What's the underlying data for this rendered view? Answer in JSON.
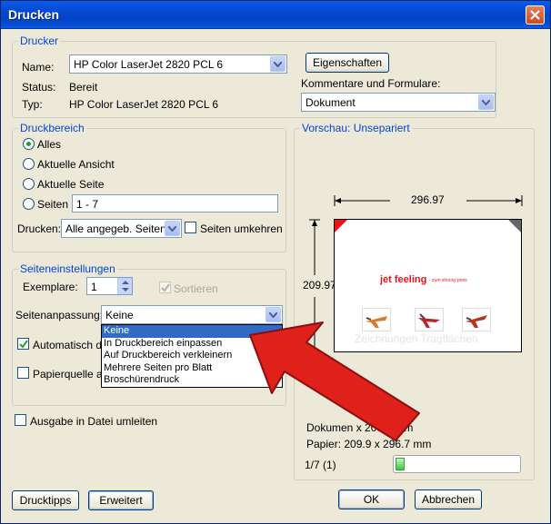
{
  "window": {
    "title": "Drucken"
  },
  "printer": {
    "legend": "Drucker",
    "name_label": "Name:",
    "name_value": "HP Color LaserJet 2820 PCL 6",
    "properties_button": "Eigenschaften",
    "status_label": "Status:",
    "status_value": "Bereit",
    "type_label": "Typ:",
    "type_value": "HP Color LaserJet 2820 PCL 6",
    "comments_label": "Kommentare und Formulare:",
    "comments_value": "Dokument"
  },
  "range": {
    "legend": "Druckbereich",
    "all": "Alles",
    "current_view": "Aktuelle Ansicht",
    "current_page": "Aktuelle Seite",
    "pages": "Seiten",
    "pages_value": "1 - 7",
    "print_label": "Drucken:",
    "print_value": "Alle angegeb. Seiten",
    "reverse_pages": "Seiten umkehren"
  },
  "page_settings": {
    "legend": "Seiteneinstellungen",
    "copies_label": "Exemplare:",
    "copies_value": "1",
    "collate": "Sortieren",
    "scaling_label": "Seitenanpassung:",
    "scaling_value": "Keine",
    "auto_rotate": "Automatisch dr",
    "paper_source": "Papierquelle ar",
    "scaling_options": [
      "Keine",
      "In Druckbereich einpassen",
      "Auf Druckbereich verkleinern",
      "Mehrere Seiten pro Blatt",
      "Broschürendruck"
    ]
  },
  "print_to_file": "Ausgabe in Datei umleiten",
  "preview": {
    "legend": "Vorschau: Unsepariert",
    "width": "296.97",
    "height": "209.97",
    "doc_title": "jet feeling",
    "doc_subtitle": "- zum shocky preis",
    "watermark": "Zeichnungen Tragflächen",
    "document_size": "Dokumen  x 209.9 mm",
    "paper_size": "Papier: 209.9 x 296.7 mm",
    "page_counter": "1/7 (1)",
    "progress": 0.07
  },
  "buttons": {
    "tips": "Drucktipps",
    "advanced": "Erweitert",
    "ok": "OK",
    "cancel": "Abbrechen"
  },
  "colors": {
    "titlebar": "#0a5ce8",
    "legend_text": "#0046d5",
    "selection": "#316ac5",
    "arrow": "#e0201a",
    "doc_title": "#e8141c"
  }
}
